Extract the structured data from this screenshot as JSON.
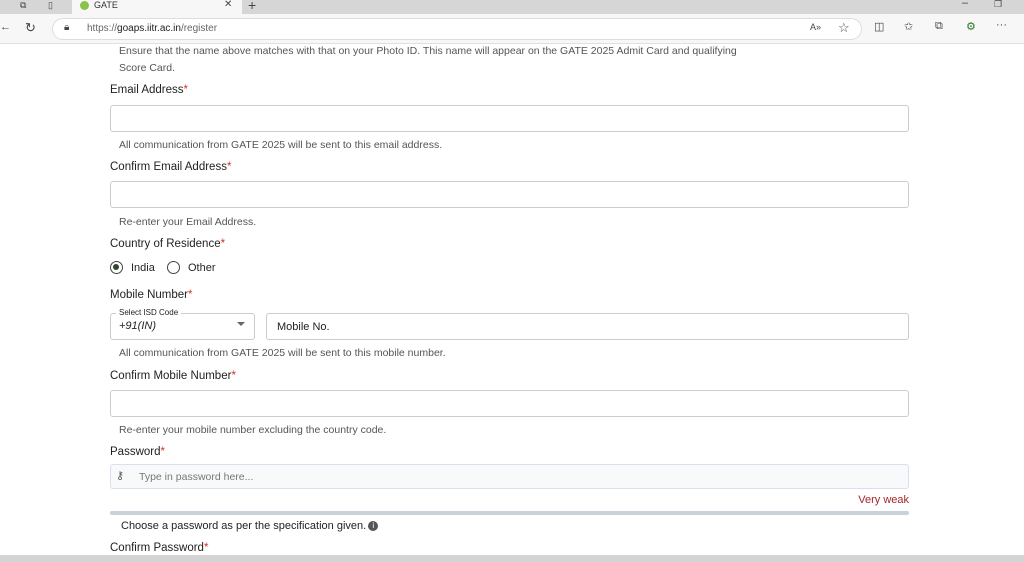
{
  "browser": {
    "tab_title": "GATE",
    "url_prefix": "https://",
    "url_host": "goaps.iitr.ac.in",
    "url_path": "/register"
  },
  "form": {
    "name_help": "Ensure that the name above matches with that on your Photo ID. This name will appear on the GATE 2025 Admit Card and qualifying",
    "name_help2": "Score Card.",
    "email_label": "Email Address",
    "email_help": "All communication from GATE 2025 will be sent to this email address.",
    "confirm_email_label": "Confirm Email Address",
    "confirm_email_help": "Re-enter your Email Address.",
    "country_label": "Country of Residence",
    "country_options": [
      "India",
      "Other"
    ],
    "country_selected": "India",
    "mobile_label": "Mobile Number",
    "isd_label": "Select ISD Code",
    "isd_value": "+91(IN)",
    "mobile_placeholder": "Mobile No.",
    "mobile_help": "All communication from GATE 2025 will be sent to this mobile number.",
    "confirm_mobile_label": "Confirm Mobile Number",
    "confirm_mobile_help": "Re-enter your mobile number excluding the country code.",
    "password_label": "Password",
    "password_placeholder": "Type in password here...",
    "strength": "Very weak",
    "strength_level": 0,
    "password_help": "Choose a password as per the specification given.",
    "confirm_password_label": "Confirm Password",
    "required_mark": "*"
  }
}
